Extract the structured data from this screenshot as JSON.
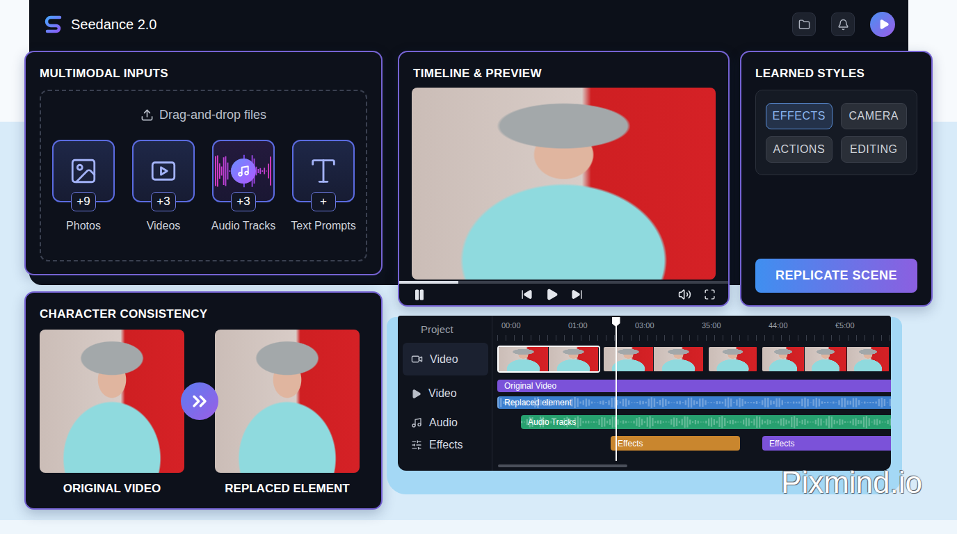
{
  "app": {
    "title": "Seedance 2.0"
  },
  "inputs": {
    "title": "MULTIMODAL INPUTS",
    "dropzone": "Drag-and-drop files",
    "items": [
      {
        "label": "Photos",
        "count": "+9",
        "kind": "photo"
      },
      {
        "label": "Videos",
        "count": "+3",
        "kind": "video"
      },
      {
        "label": "Audio Tracks",
        "count": "+3",
        "kind": "audio"
      },
      {
        "label": "Text Prompts",
        "count": "+",
        "kind": "text"
      }
    ]
  },
  "preview": {
    "title": "TIMELINE & PREVIEW",
    "playing": true,
    "progress": 0.18
  },
  "styles": {
    "title": "LEARNED STYLES",
    "chips": [
      {
        "label": "EFFECTS",
        "selected": true
      },
      {
        "label": "CAMERA",
        "selected": false
      },
      {
        "label": "ACTIONS",
        "selected": false
      },
      {
        "label": "EDITING",
        "selected": false
      }
    ],
    "action": "REPLICATE SCENE"
  },
  "character": {
    "title": "CHARACTER CONSISTENCY",
    "before": "ORIGINAL VIDEO",
    "after": "REPLACED ELEMENT"
  },
  "timeline": {
    "header": "Project",
    "ruler": [
      "00:00",
      "01:00",
      "03:00",
      "35:00",
      "44:00",
      "€5:00"
    ],
    "playhead": 0.3,
    "tracks": [
      {
        "label": "Video",
        "kind": "video",
        "selected": true
      },
      {
        "label": "Video",
        "kind": "play",
        "selected": false
      },
      {
        "label": "Audio",
        "kind": "audio",
        "selected": false
      },
      {
        "label": "Effects",
        "kind": "effects",
        "selected": false
      }
    ],
    "clips": [
      {
        "frames": 2,
        "selected": true
      },
      {
        "frames": 2,
        "selected": false
      },
      {
        "frames": 1,
        "selected": false
      },
      {
        "frames": 3,
        "selected": false
      }
    ],
    "lanes": [
      [
        {
          "label": "Original Video",
          "color": "#7b52d9",
          "kind": "plain"
        }
      ],
      [
        {
          "label": "Replaced element",
          "color": "#3b7fcf",
          "kind": "wave"
        }
      ],
      [
        {
          "label": "Audio Tracks",
          "color": "#27a06f",
          "kind": "wave"
        }
      ],
      [
        {
          "label": "Effects",
          "color": "#c9862e",
          "kind": "plain"
        },
        {
          "label": "Effects",
          "color": "#7b52d9",
          "kind": "plain"
        }
      ]
    ]
  },
  "watermark": "Pixmind.io"
}
